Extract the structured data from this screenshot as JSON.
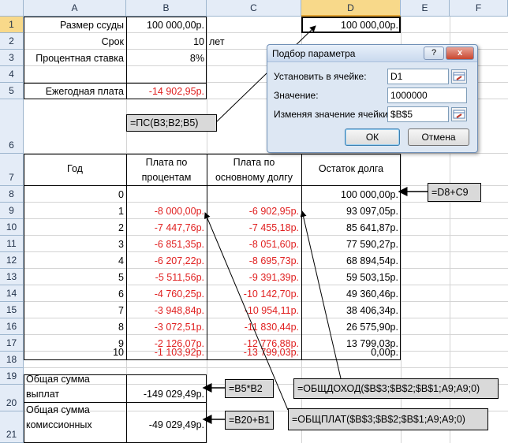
{
  "columns": [
    "A",
    "B",
    "C",
    "D",
    "E",
    "F"
  ],
  "rows": [
    "1",
    "2",
    "3",
    "4",
    "5",
    "6",
    "7",
    "8",
    "9",
    "10",
    "11",
    "12",
    "13",
    "14",
    "15",
    "16",
    "17",
    "18",
    "19",
    "20",
    "21"
  ],
  "cells": {
    "a1": "Размер ссуды",
    "b1": "100 000,00р.",
    "d1": "100 000,00р.",
    "a2": "Срок",
    "b2": "10",
    "c2": "лет",
    "a3": "Процентная ставка",
    "b3": "8%",
    "a5": "Ежегодная плата",
    "b5": "-14 902,95р.",
    "a7": "Год",
    "b7a": "Плата по",
    "b7b": "процентам",
    "c7a": "Плата по",
    "c7b": "основному долгу",
    "d7": "Остаток долга",
    "a20a": "Общая сумма",
    "a20b": "выплат",
    "b20": "-149 029,49р.",
    "a21a": "Общая сумма",
    "a21b": "комиссионных",
    "b21": "-49 029,49р."
  },
  "table": [
    {
      "year": "0",
      "interest": "",
      "principal": "",
      "balance": "100 000,00р."
    },
    {
      "year": "1",
      "interest": "-8 000,00р.",
      "principal": "-6 902,95р.",
      "balance": "93 097,05р."
    },
    {
      "year": "2",
      "interest": "-7 447,76р.",
      "principal": "-7 455,18р.",
      "balance": "85 641,87р."
    },
    {
      "year": "3",
      "interest": "-6 851,35р.",
      "principal": "-8 051,60р.",
      "balance": "77 590,27р."
    },
    {
      "year": "4",
      "interest": "-6 207,22р.",
      "principal": "-8 695,73р.",
      "balance": "68 894,54р."
    },
    {
      "year": "5",
      "interest": "-5 511,56р.",
      "principal": "-9 391,39р.",
      "balance": "59 503,15р."
    },
    {
      "year": "6",
      "interest": "-4 760,25р.",
      "principal": "-10 142,70р.",
      "balance": "49 360,46р."
    },
    {
      "year": "7",
      "interest": "-3 948,84р.",
      "principal": "-10 954,11р.",
      "balance": "38 406,34р."
    },
    {
      "year": "8",
      "interest": "-3 072,51р.",
      "principal": "-11 830,44р.",
      "balance": "26 575,90р."
    },
    {
      "year": "9",
      "interest": "-2 126,07р.",
      "principal": "-12 776,88р.",
      "balance": "13 799,03р."
    },
    {
      "year": "10",
      "interest": "-1 103,92р.",
      "principal": "-13 799,03р.",
      "balance": "0,00р."
    }
  ],
  "callouts": {
    "pv": "=ПС(B3;B2;B5)",
    "balance": "=D8+C9",
    "total_pay": "=B5*B2",
    "total_fee": "=B20+B1",
    "cumprinc": "=ОБЩДОХОД($B$3;$B$2;$B$1;A9;A9;0)",
    "cumipmt": "=ОБЩПЛАТ($B$3;$B$2;$B$1;A9;A9;0)"
  },
  "dialog": {
    "title": "Подбор параметра",
    "help": "?",
    "close": "x",
    "set_cell_label": "Установить в ячейке:",
    "set_cell_value": "D1",
    "value_label": "Значение:",
    "value_value": "1000000",
    "changing_label": "Изменяя значение ячейки:",
    "changing_value": "$B$5",
    "ok": "ОК",
    "cancel": "Отмена"
  },
  "colors": {
    "negative": "#e02020",
    "selected_header": "#f8d98a",
    "callout_bg": "#d9d9d9"
  }
}
